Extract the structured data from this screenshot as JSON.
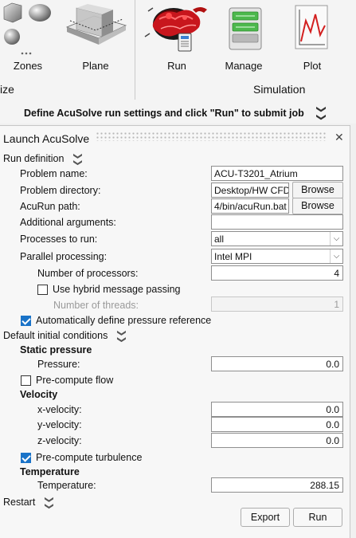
{
  "ribbon": {
    "tools": [
      {
        "label": "Zones",
        "icon": "zones-icon"
      },
      {
        "label": "Plane",
        "icon": "plane-icon"
      },
      {
        "label": "Run",
        "icon": "run-icon"
      },
      {
        "label": "Manage",
        "icon": "manage-icon"
      },
      {
        "label": "Plot",
        "icon": "plot-icon"
      }
    ],
    "groups": {
      "left": "ize",
      "right": "Simulation"
    },
    "banner": "Define AcuSolve run settings and click \"Run\" to submit job",
    "banner_chevron": "❯❯"
  },
  "panel": {
    "title": "Launch AcuSolve",
    "close": "✕",
    "run_definition": {
      "header": "Run definition",
      "problem_name_label": "Problem name:",
      "problem_name_value": "ACU-T3201_Atrium",
      "problem_directory_label": "Problem directory:",
      "problem_directory_value": "Desktop/HW CFD",
      "acurun_path_label": "AcuRun path:",
      "acurun_path_value": "4/bin/acuRun.bat",
      "browse_label": "Browse",
      "additional_arguments_label": "Additional arguments:",
      "additional_arguments_value": "",
      "processes_label": "Processes to run:",
      "processes_value": "all",
      "parallel_label": "Parallel processing:",
      "parallel_value": "Intel MPI",
      "num_processors_label": "Number of processors:",
      "num_processors_value": "4",
      "hybrid_label": "Use hybrid message passing",
      "hybrid_checked": false,
      "num_threads_label": "Number of threads:",
      "num_threads_value": "1",
      "auto_pressure_label": "Automatically define pressure reference",
      "auto_pressure_checked": true
    },
    "initial_conditions": {
      "header": "Default initial conditions",
      "static_pressure_header": "Static pressure",
      "pressure_label": "Pressure:",
      "pressure_value": "0.0",
      "precompute_flow_label": "Pre-compute flow",
      "precompute_flow_checked": false,
      "velocity_header": "Velocity",
      "x_velocity_label": "x-velocity:",
      "x_velocity_value": "0.0",
      "y_velocity_label": "y-velocity:",
      "y_velocity_value": "0.0",
      "z_velocity_label": "z-velocity:",
      "z_velocity_value": "0.0",
      "precompute_turbulence_label": "Pre-compute turbulence",
      "precompute_turbulence_checked": true,
      "temperature_header": "Temperature",
      "temperature_label": "Temperature:",
      "temperature_value": "288.15"
    },
    "restart": {
      "header": "Restart"
    },
    "buttons": {
      "export": "Export",
      "run": "Run"
    },
    "collapse_chevron": "❮❮",
    "expand_chevron": "❯❯"
  },
  "colors": {
    "check_accent": "#1a73c8",
    "run_icon_red": "#c8161d",
    "plot_icon_red": "#d32020"
  }
}
